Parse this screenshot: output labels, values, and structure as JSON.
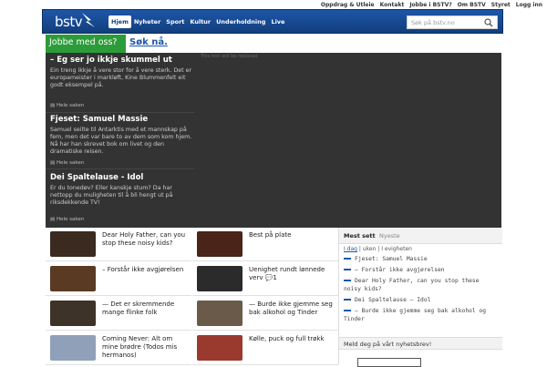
{
  "topbar": {
    "links": [
      "Oppdrag & Utleie",
      "Kontakt",
      "Jobbe i BSTV?",
      "Om BSTV",
      "Styret",
      "Logg inn"
    ]
  },
  "header": {
    "logo": "bstv",
    "nav": [
      "Hjem",
      "Nyheter",
      "Sport",
      "Kultur",
      "Underholdning",
      "Live"
    ],
    "search_placeholder": "Søk på bstv.no"
  },
  "banner": {
    "question": "Jobbe med oss?",
    "action": "Søk nå."
  },
  "video_placeholder": "This text will be replaced",
  "stories": [
    {
      "title": "– Eg ser jo ikkje skummel ut",
      "text": "Ein treng ikkje å vere stor for å vere sterk. Det er europameister i markløft, Kine Blummenfelt eit godt eksempel på.",
      "more": "Hele saken"
    },
    {
      "title": "Fjeset: Samuel Massie",
      "text": "Samuel seilte til Antarktis med et mannskap på fem, men det var bare to av dem som kom hjem. Nå har han skrevet bok om livet og den dramatiske reisen.",
      "more": "Hele saken"
    },
    {
      "title": "Dei Spaltelause - Idol",
      "text": "Er du tonedøv? Eller kanskje stum? Da har nettopp du muligheten til å bli hengt ut på riksdekkende TV!",
      "more": "Hele saken"
    }
  ],
  "tiles": [
    {
      "text": "Dear Holy Father, can you stop these noisy kids?",
      "color": "#3a2a20"
    },
    {
      "text": "Best på plate",
      "color": "#4a2418"
    },
    {
      "text": "– Forstår ikke avgjørelsen",
      "color": "#5a3a22"
    },
    {
      "text": "Uenighet rundt lønnede verv 💬1",
      "color": "#2b2b2b"
    },
    {
      "text": "— Det er skremmende mange flinke folk",
      "color": "#3d3328"
    },
    {
      "text": "— Burde ikke gjemme seg bak alkohol og Tinder",
      "color": "#6a5a4a"
    },
    {
      "text": "Coming Never: Alt om mine brødre (Todos mis hermanos)",
      "color": "#8fa0b8"
    },
    {
      "text": "Kølle, puck og full trøkk",
      "color": "#9a3a2e"
    }
  ],
  "sidebar": {
    "tabs": [
      "Mest sett",
      "Nyeste"
    ],
    "filters": [
      "I dag",
      "uken",
      "I evigheten"
    ],
    "list": [
      "Fjeset: Samuel Massie",
      "– Forstår ikke avgjørelsen",
      "Dear Holy Father, can you stop these noisy kids?",
      "Dei Spaltelause – Idol",
      "— Burde ikke gjemme seg bak alkohol og Tinder"
    ],
    "newsletter": "Meld deg på vårt nyhetsbrev!"
  },
  "colors": {
    "brand": "#1e57a8",
    "job_green": "#2c9c3a",
    "dark_panel": "#333333"
  }
}
